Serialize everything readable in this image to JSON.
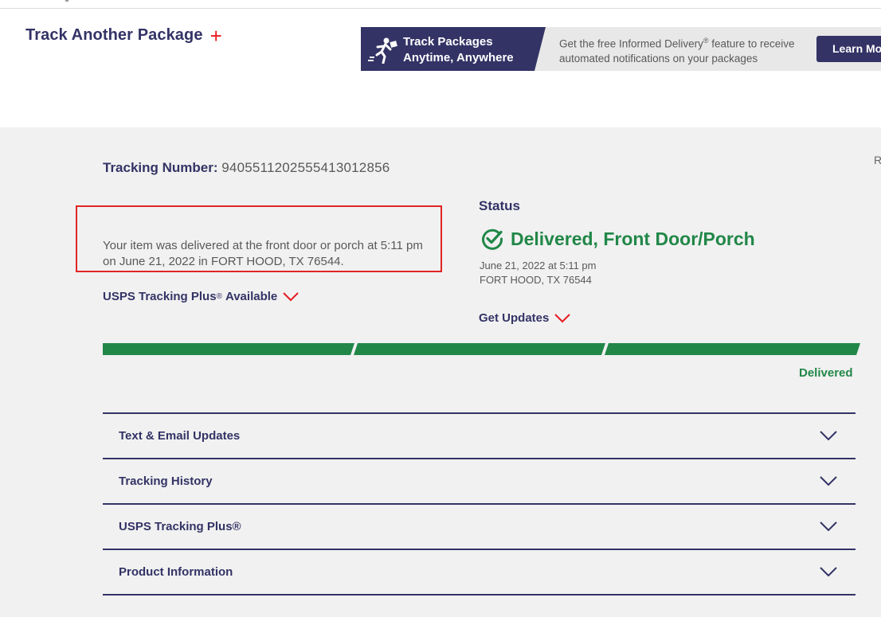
{
  "header": {
    "track_another": "Track Another Package",
    "track_another_plus": "+"
  },
  "banner": {
    "title_line1": "Track Packages",
    "title_line2": "Anytime, Anywhere",
    "message_part1": "Get the free Informed Delivery",
    "message_reg": "®",
    "message_part2": " feature to receive automated notifications on your packages",
    "learn_more": "Learn More",
    "icon": "runner-with-package-icon"
  },
  "tracking": {
    "label": "Tracking Number:",
    "number": "9405511202555413012856",
    "edge_text": "R",
    "summary": "Your item was delivered at the front door or porch at 5:11 pm on June 21, 2022 in FORT HOOD, TX 76544.",
    "plus_available_part1": "USPS Tracking Plus",
    "plus_available_reg": "®",
    "plus_available_part2": "Available"
  },
  "status": {
    "heading": "Status",
    "main": "Delivered, Front Door/Porch",
    "date": "June 21, 2022 at 5:11 pm",
    "location": "FORT HOOD, TX 76544",
    "get_updates": "Get Updates",
    "progress_label": "Delivered",
    "progress_segments_complete": 3,
    "progress_segments_total": 3
  },
  "accordion": [
    {
      "label": "Text & Email Updates"
    },
    {
      "label": "Tracking History"
    },
    {
      "label": "USPS Tracking Plus®"
    },
    {
      "label": "Product Information"
    }
  ],
  "colors": {
    "navy": "#333366",
    "green": "#218748",
    "red": "#e71921",
    "page_bg": "#f1f1f1"
  }
}
